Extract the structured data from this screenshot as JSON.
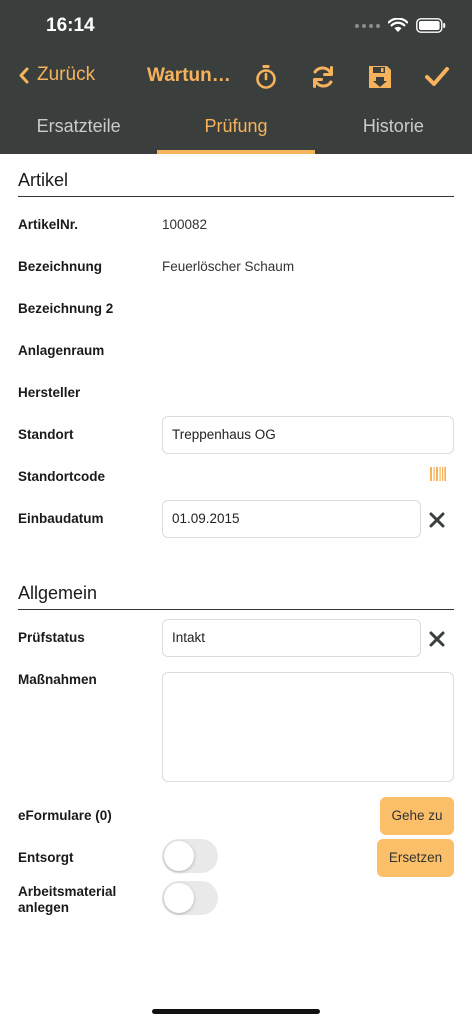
{
  "status": {
    "time": "16:14"
  },
  "nav": {
    "back_label": "Zurück",
    "title": "Wartun…"
  },
  "tabs": [
    {
      "label": "Ersatzteile",
      "active": false
    },
    {
      "label": "Prüfung",
      "active": true
    },
    {
      "label": "Historie",
      "active": false
    }
  ],
  "artikel": {
    "section_title": "Artikel",
    "artikelnr_label": "ArtikelNr.",
    "artikelnr_value": "100082",
    "bezeichnung_label": "Bezeichnung",
    "bezeichnung_value": "Feuerlöscher Schaum",
    "bezeichnung2_label": "Bezeichnung 2",
    "anlagenraum_label": "Anlagenraum",
    "hersteller_label": "Hersteller",
    "standort_label": "Standort",
    "standort_value": "Treppenhaus OG",
    "standortcode_label": "Standortcode",
    "einbaudatum_label": "Einbaudatum",
    "einbaudatum_value": "01.09.2015"
  },
  "allgemein": {
    "section_title": "Allgemein",
    "pruefstatus_label": "Prüfstatus",
    "pruefstatus_value": "Intakt",
    "massnahmen_label": "Maßnahmen",
    "massnahmen_value": "",
    "eformulare_label": "eFormulare (0)",
    "gehe_zu_label": "Gehe zu",
    "entsorgt_label": "Entsorgt",
    "ersetzen_label": "Ersetzen",
    "arbeitsmaterial_label_1": "Arbeitsmaterial",
    "arbeitsmaterial_label_2": "anlegen"
  },
  "colors": {
    "accent": "#f7b35b",
    "header_bg": "#3a3f3d",
    "button_bg": "#fbbf6a"
  },
  "icons": [
    "wifi-icon",
    "battery-icon",
    "chevron-left-icon",
    "timer-icon",
    "refresh-icon",
    "save-icon",
    "checkmark-icon",
    "barcode-icon",
    "close-icon"
  ]
}
